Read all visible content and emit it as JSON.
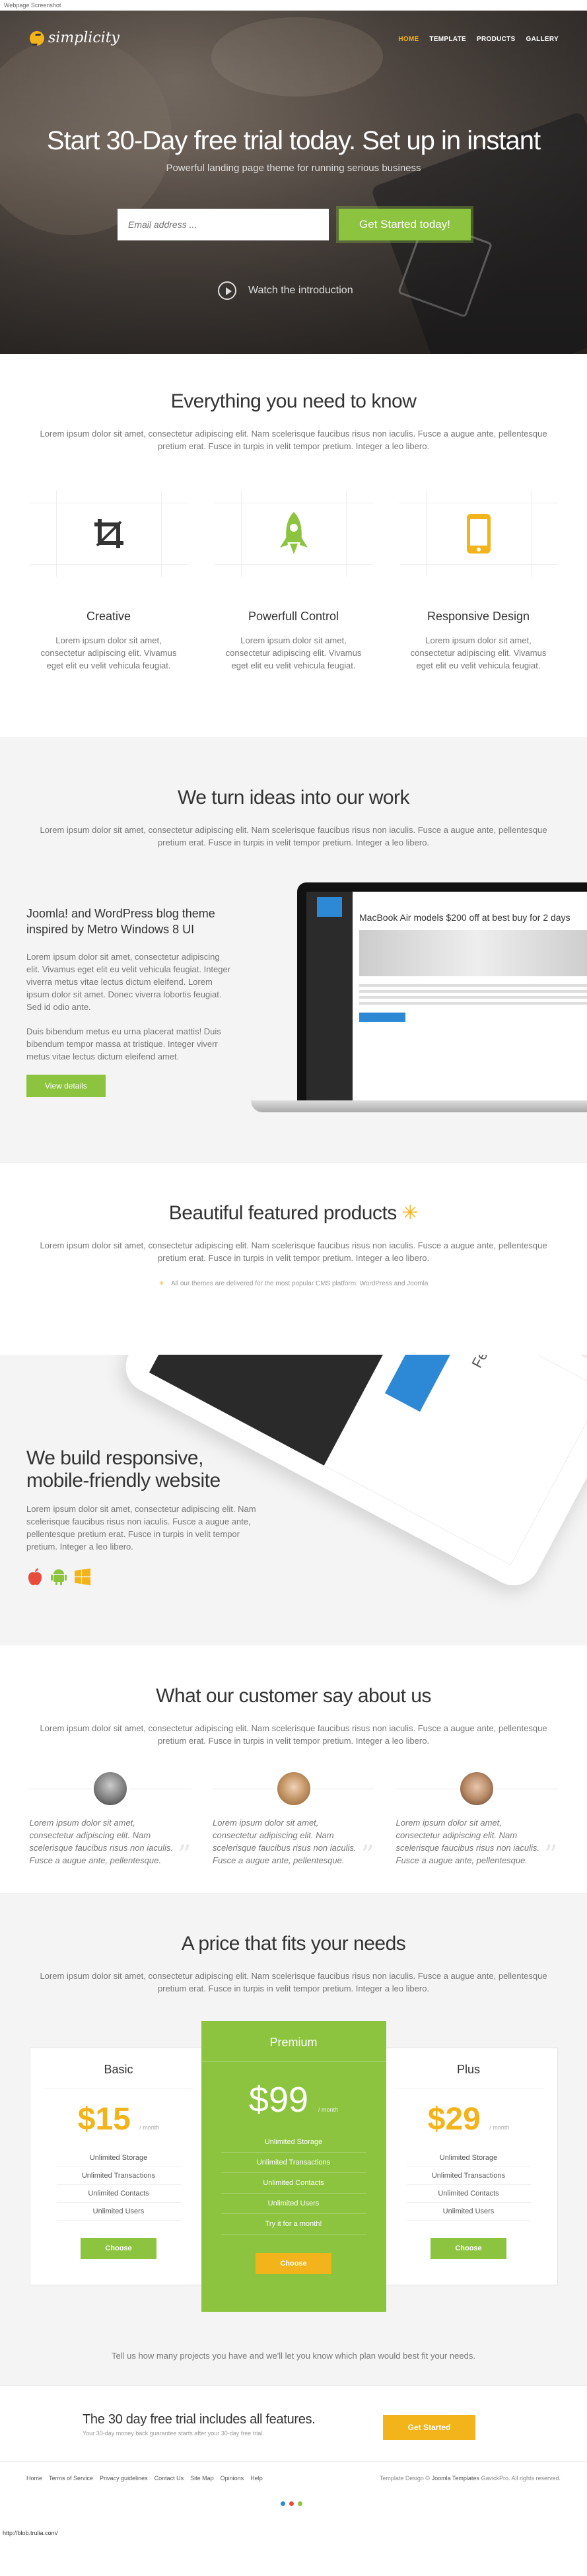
{
  "topbar": {
    "label": "Webpage Screenshot"
  },
  "nav": {
    "brand": "simplicity",
    "items": [
      {
        "label": "HOME",
        "active": true
      },
      {
        "label": "TEMPLATE",
        "active": false
      },
      {
        "label": "PRODUCTS",
        "active": false
      },
      {
        "label": "GALLERY",
        "active": false
      }
    ]
  },
  "hero": {
    "title": "Start 30-Day free trial today. Set up in instant",
    "subtitle": "Powerful landing page theme for running serious business",
    "email_placeholder": "Email address ...",
    "cta_label": "Get Started today!",
    "watch_label": "Watch the introduction"
  },
  "features": {
    "title": "Everything you need to know",
    "intro": "Lorem ipsum dolor sit amet, consectetur adipiscing elit. Nam scelerisque faucibus risus non iaculis. Fusce a augue ante, pellentesque pretium erat. Fusce in turpis in velit tempor pretium. Integer a leo libero.",
    "items": [
      {
        "title": "Creative",
        "icon": "crop-icon",
        "color": "#333333",
        "text": "Lorem ipsum dolor sit amet, consectetur adipiscing elit. Vivamus eget elit eu velit vehicula feugiat."
      },
      {
        "title": "Powerfull Control",
        "icon": "rocket-icon",
        "color": "#8cc440",
        "text": "Lorem ipsum dolor sit amet, consectetur adipiscing elit. Vivamus eget elit eu velit vehicula feugiat."
      },
      {
        "title": "Responsive Design",
        "icon": "phone-icon",
        "color": "#f2b31b",
        "text": "Lorem ipsum dolor sit amet, consectetur adipiscing elit. Vivamus eget elit eu velit vehicula feugiat."
      }
    ]
  },
  "ideas": {
    "title": "We turn ideas into our work",
    "intro": "Lorem ipsum dolor sit amet, consectetur adipiscing elit. Nam scelerisque faucibus risus non iaculis. Fusce a augue ante, pellentesque pretium erat. Fusce in turpis in velit tempor pretium. Integer a leo libero.",
    "heading": "Joomla! and WordPress blog theme inspired by Metro Windows 8 UI",
    "para1": "Lorem ipsum dolor sit amet, consectetur adipiscing elit. Vivamus eget elit eu velit vehicula feugiat. Integer viverra metus vitae lectus dictum eleifend. Lorem ipsum dolor sit amet. Donec viverra lobortis feugiat. Sed id odio ante.",
    "para2": "Duis bibendum metus eu urna placerat mattis! Duis bibendum tempor massa at tristique. Integer viverr metus vitae lectus dictum eleifend amet.",
    "button": "View details",
    "screen_title": "MacBook Air models $200 off at best buy for 2 days"
  },
  "products": {
    "title": "Beautiful featured products",
    "intro": "Lorem ipsum dolor sit amet, consectetur adipiscing elit. Nam scelerisque faucibus risus non iaculis. Fusce a augue ante, pellentesque pretium erat. Fusce in turpis in velit tempor pretium. Integer a leo libero.",
    "note": "All our themes are delivered for the most popular CMS platform: WordPress and Joomla"
  },
  "responsive": {
    "title": "We build responsive, mobile-friendly website",
    "text": "Lorem ipsum dolor sit amet, consectetur adipiscing elit. Nam scelerisque faucibus risus non iaculis. Fusce a augue ante, pellentesque pretium erat. Fusce in turpis in velit tempor pretium. Integer a leo libero.",
    "tablet_text": "Featured News"
  },
  "testimonials": {
    "title": "What our customer say about us",
    "intro": "Lorem ipsum dolor sit amet, consectetur adipiscing elit. Nam scelerisque faucibus risus non iaculis. Fusce a augue ante, pellentesque pretium erat. Fusce in turpis in velit tempor pretium. Integer a leo libero.",
    "items": [
      {
        "text": "Lorem ipsum dolor sit amet, consectetur adipiscing elit. Nam scelerisque faucibus risus non iaculis. Fusce a augue ante, pellentesque."
      },
      {
        "text": "Lorem ipsum dolor sit amet, consectetur adipiscing elit. Nam scelerisque faucibus risus non iaculis. Fusce a augue ante, pellentesque."
      },
      {
        "text": "Lorem ipsum dolor sit amet, consectetur adipiscing elit. Nam scelerisque faucibus risus non iaculis. Fusce a augue ante, pellentesque."
      }
    ]
  },
  "pricing": {
    "title": "A price that fits your needs",
    "intro": "Lorem ipsum dolor sit amet, consectetur adipiscing elit. Nam scelerisque faucibus risus non iaculis. Fusce a augue ante, pellentesque pretium erat. Fusce in turpis in velit tempor pretium. Integer a leo libero.",
    "plans": [
      {
        "name": "Basic",
        "price": "$15",
        "per": "/ month",
        "features": [
          "Unlimited Storage",
          "Unlimited Transactions",
          "Unlimited Contacts",
          "Unlimited Users"
        ],
        "button": "Choose"
      },
      {
        "name": "Premium",
        "price": "$99",
        "per": "/ month",
        "features": [
          "Unlimited Storage",
          "Unlimited Transactions",
          "Unlimited Contacts",
          "Unlimited Users",
          "Try it for a month!"
        ],
        "button": "Choose"
      },
      {
        "name": "Plus",
        "price": "$29",
        "per": "/ month",
        "features": [
          "Unlimited Storage",
          "Unlimited Transactions",
          "Unlimited Contacts",
          "Unlimited Users"
        ],
        "button": "Choose"
      }
    ],
    "tell": "Tell us how many projects you have and we'll let you know which plan would best fit your needs."
  },
  "trial": {
    "headline": "The 30 day free trial includes all features.",
    "sub": "Your 30-day money back guarantee starts after your 30-day free trial.",
    "button": "Get Started"
  },
  "footer": {
    "links": [
      "Home",
      "Terms of Service",
      "Privacy guidelines",
      "Contact Us",
      "Site Map",
      "Opinions",
      "Help"
    ],
    "copyright_prefix": "Template Design ©",
    "brand": "Joomla Templates",
    "copyright_suffix": "GavickPro. All rights reserved.",
    "dot_colors": [
      "#2d89d6",
      "#e84c3d",
      "#8cc440"
    ],
    "bottom_url": "http://blob.trulia.com/"
  },
  "colors": {
    "accent_green": "#8cc440",
    "accent_yellow": "#f2b31b",
    "accent_blue": "#2d89d6"
  }
}
